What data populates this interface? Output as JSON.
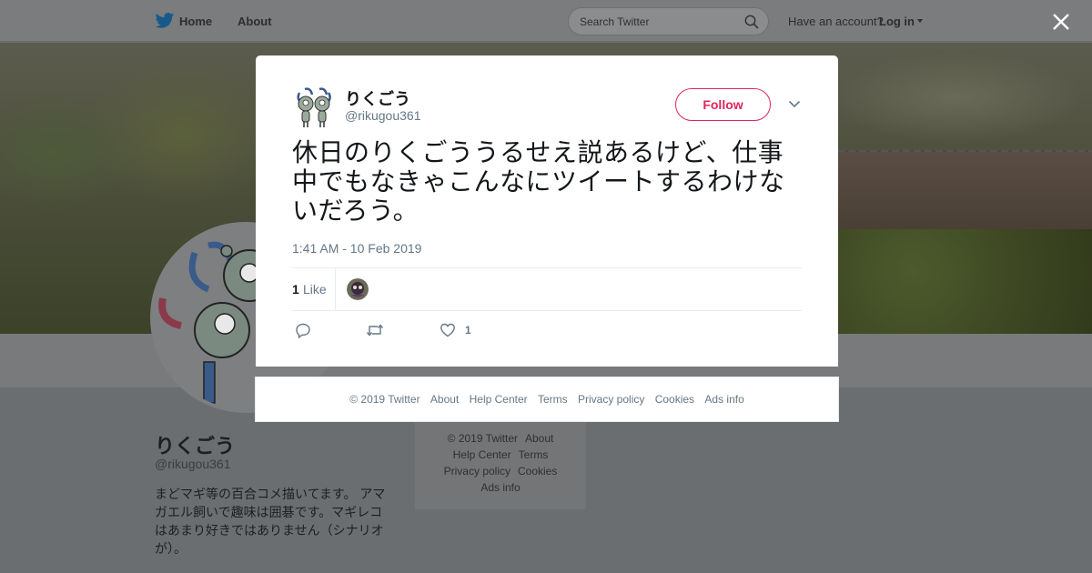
{
  "nav": {
    "home_label": "Home",
    "about_label": "About",
    "search_placeholder": "Search Twitter",
    "have_account": "Have an account?",
    "login_label": "Log in",
    "brand_color": "#1da1f2",
    "icons": [
      "twitter-bird-icon",
      "search-icon",
      "chevron-down-icon",
      "close-icon"
    ]
  },
  "profile": {
    "name": "りくごう",
    "handle": "@rikugou361",
    "bio": "まどマギ等の百合コメ描いてます。 アマガエル飼いで趣味は囲碁です。マギレコはあまり好きではありません（シナリオが）。"
  },
  "side_footer": {
    "links": [
      "© 2019 Twitter",
      "About",
      "Help Center",
      "Terms",
      "Privacy policy",
      "Cookies",
      "Ads info"
    ]
  },
  "tweet": {
    "author_name": "りくごう",
    "author_handle": "@rikugou361",
    "follow_label": "Follow",
    "text": "休日のりくごううるせえ説あるけど、仕事中でもなきゃこんなにツイートするわけないだろう。",
    "timestamp": "1:41 AM - 10 Feb 2019",
    "like_count": "1",
    "like_label": "Like",
    "action_like_count": "1",
    "accent_color": "#e0245e"
  },
  "modal_footer": {
    "links": [
      "© 2019 Twitter",
      "About",
      "Help Center",
      "Terms",
      "Privacy policy",
      "Cookies",
      "Ads info"
    ]
  }
}
